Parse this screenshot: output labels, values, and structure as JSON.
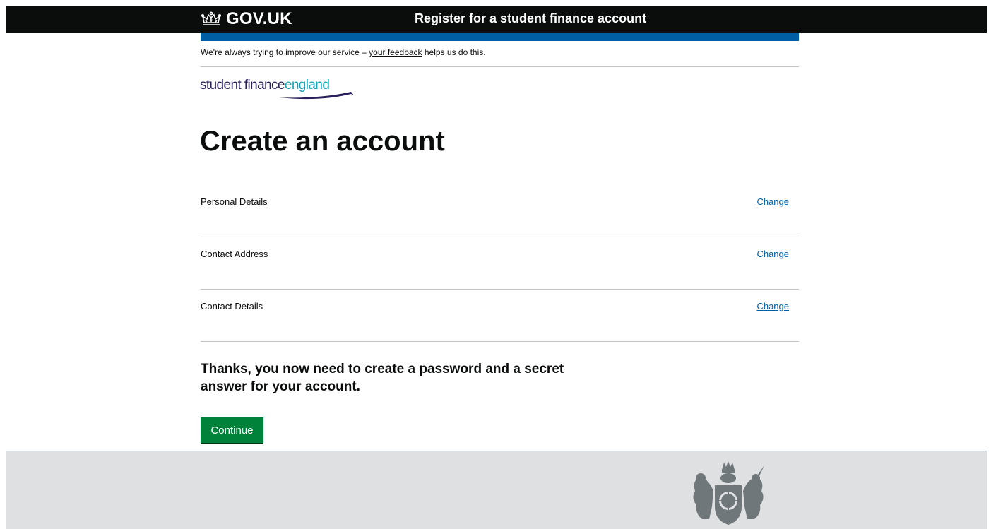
{
  "header": {
    "logo_text": "GOV.UK",
    "service_name": "Register for a student finance account"
  },
  "feedback": {
    "prefix": "We're always trying to improve our service – ",
    "link_text": "your feedback",
    "suffix": " helps us do this."
  },
  "brand": {
    "word1": "student finance",
    "word2": "england"
  },
  "page": {
    "title": "Create an account"
  },
  "summary": {
    "rows": [
      {
        "label": "Personal Details",
        "action": "Change"
      },
      {
        "label": "Contact Address",
        "action": "Change"
      },
      {
        "label": "Contact Details",
        "action": "Change"
      }
    ]
  },
  "message": "Thanks, you now need to create a password and a secret answer for your account.",
  "actions": {
    "continue_label": "Continue"
  },
  "colors": {
    "header_bg": "#0b0c0c",
    "blue_bar": "#005ea5",
    "link": "#005ea5",
    "button_green": "#00823b",
    "footer_bg": "#dee0e2",
    "brand_purple": "#2b1f5c",
    "brand_teal": "#16a5b6"
  }
}
